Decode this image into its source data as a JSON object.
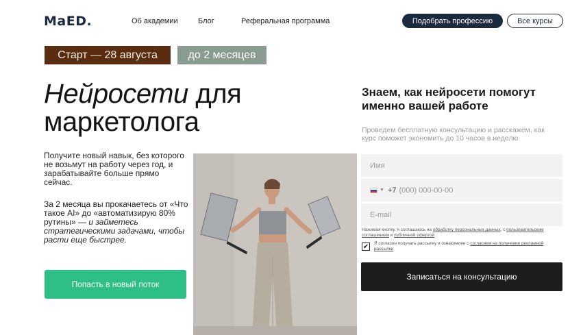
{
  "header": {
    "logo": "MaED.",
    "nav": [
      "Об академии",
      "Блог",
      "Реферальная программа"
    ],
    "pick_button": "Подобрать профессию",
    "all_courses_button": "Все курсы"
  },
  "tags": {
    "start": "Старт —  28 августа",
    "duration": "до 2 месяцев"
  },
  "hero": {
    "title_italic": "Нейросети",
    "title_rest_line1": " для",
    "title_line2": "маркетолога",
    "lead_text": "Получите новый навык, без которого не возьмут на работу через год, и зарабатывайте больше прямо сейчас.",
    "lead2_part1": "За 2 месяца вы прокачаетесь от «Что такое AI» до «автоматизирую 80% рутины» —",
    "lead2_part2": "и займетесь стратегическими задачами, чтобы расти еще быстрее.",
    "cta": "Попасть в новый поток"
  },
  "form": {
    "title": "Знаем, как нейросети помогут именно вашей работе",
    "subtitle": "Проведем бесплатную консультацию и расскажем, как курс поможет экономить до 10 часов в неделю",
    "name_placeholder": "Имя",
    "phone_prefix": "+7",
    "phone_placeholder": "(000) 000-00-00",
    "email_placeholder": "E-mail",
    "consent_1a": "Нажимая кнопку, я соглашаюсь на ",
    "consent_1b": "обработку персональных данных",
    "consent_1c": ", с ",
    "consent_1d": "пользовательским соглашением",
    "consent_1e": " и ",
    "consent_1f": "публичной офертой",
    "consent_2a": "Я согласен получать рассылку и ознакомлен с ",
    "consent_2b": "согласием на получение рекламной рассылки",
    "checkbox_checked": true,
    "submit": "Записаться на консультацию"
  },
  "colors": {
    "navy": "#1b2a3e",
    "start_tag": "#5a2d10",
    "duration_tag": "#8a9c90",
    "green_cta": "#2ebf86",
    "submit": "#1d1d1d"
  },
  "photo": {
    "alt_icon": "woman-with-laptops-photo"
  }
}
